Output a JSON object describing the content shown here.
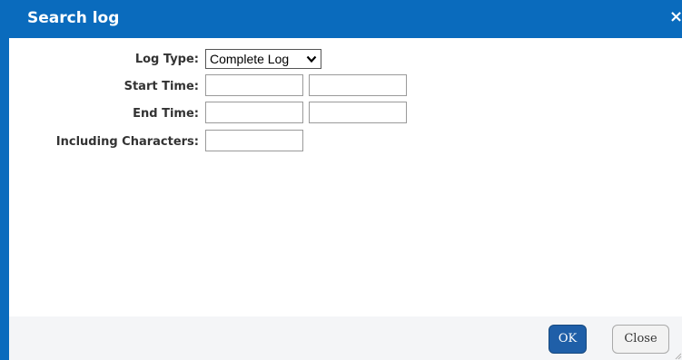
{
  "dialog": {
    "title": "Search log",
    "close_glyph": "×"
  },
  "form": {
    "log_type": {
      "label": "Log Type:",
      "selected": "Complete Log"
    },
    "start_time": {
      "label": "Start Time:",
      "date_value": "",
      "time_value": ""
    },
    "end_time": {
      "label": "End Time:",
      "date_value": "",
      "time_value": ""
    },
    "including_characters": {
      "label": "Including Characters:",
      "value": ""
    }
  },
  "footer": {
    "ok_label": "OK",
    "close_label": "Close"
  },
  "colors": {
    "title_bar": "#0a6bbd",
    "ok_button": "#1f5fa8",
    "footer_bg": "#f4f5f7"
  },
  "icons": {
    "close": "close-icon",
    "dropdown": "chevron-down-icon"
  }
}
